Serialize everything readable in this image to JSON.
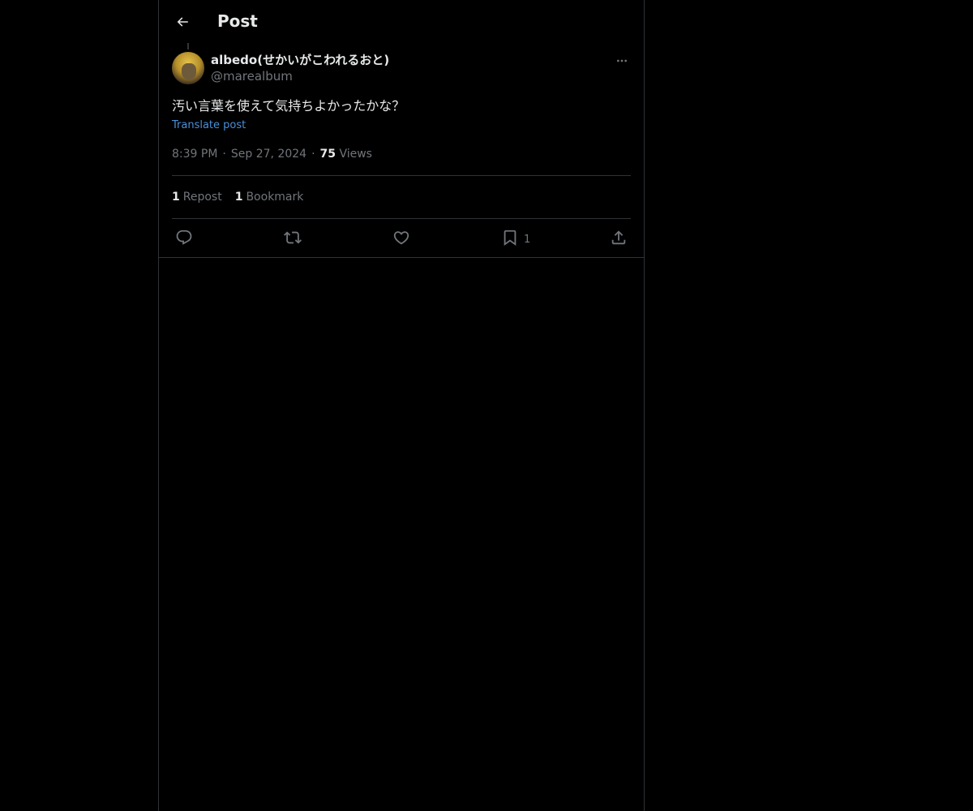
{
  "header": {
    "title": "Post"
  },
  "post": {
    "author": {
      "display_name": "albedo(せかいがこわれるおと)",
      "handle": "@marealbum"
    },
    "text": "汚い言葉を使えて気持ちよかったかな？",
    "translate_label": "Translate post",
    "time": "8:39 PM",
    "date": "Sep 27, 2024",
    "views_count": "75",
    "views_label": "Views",
    "separator": "·",
    "stats": {
      "reposts_count": "1",
      "reposts_label": "Repost",
      "bookmarks_count": "1",
      "bookmarks_label": "Bookmark"
    },
    "actions": {
      "bookmark_count": "1"
    }
  },
  "colors": {
    "background": "#000000",
    "text_primary": "#e7e9ea",
    "text_secondary": "#71767b",
    "link": "#4a8fd8",
    "border": "#2f3336"
  },
  "icons": {
    "back": "arrow-left-icon",
    "more": "more-dots-icon",
    "reply": "reply-icon",
    "repost": "repost-icon",
    "like": "heart-icon",
    "bookmark": "bookmark-icon",
    "share": "share-icon"
  }
}
